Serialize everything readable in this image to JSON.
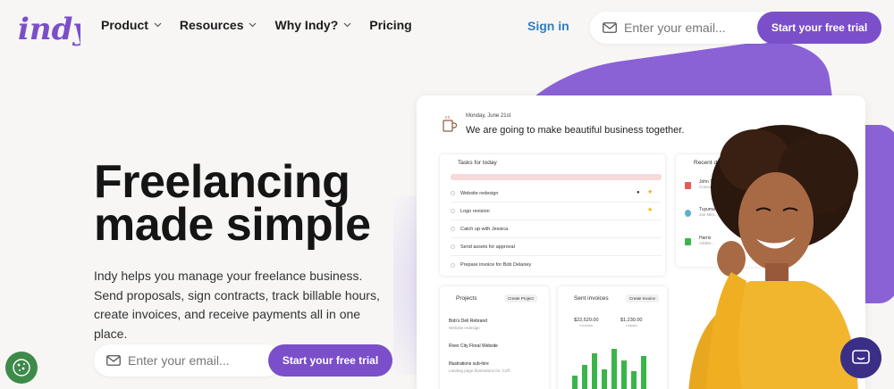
{
  "brand": {
    "logo_text": "indy",
    "color": "#7b4fc9"
  },
  "nav": [
    {
      "label": "Product",
      "has_dropdown": true
    },
    {
      "label": "Resources",
      "has_dropdown": true
    },
    {
      "label": "Why Indy?",
      "has_dropdown": true
    },
    {
      "label": "Pricing",
      "has_dropdown": false
    }
  ],
  "header": {
    "sign_in": "Sign in",
    "email_placeholder": "Enter your email...",
    "cta": "Start your free trial"
  },
  "hero": {
    "headline_line1": "Freelancing",
    "headline_line2": "made simple",
    "subcopy": "Indy helps you manage your freelance business. Send proposals, sign contracts, track billable hours, create invoices, and receive payments all in one place.",
    "email_placeholder": "Enter your email...",
    "cta": "Start your free trial"
  },
  "dashboard": {
    "date": "Monday, June 21st",
    "greeting": "We are going to make beautiful business together.",
    "tasks": {
      "title": "Tasks for today",
      "items": [
        "Website redesign",
        "Logo revision",
        "Catch up with Jessica",
        "Send assets for approval",
        "Prepare invoice for Bob Delaney"
      ]
    },
    "recent_docs": {
      "title": "Recent documents",
      "items": [
        {
          "name": "John Tash",
          "sub": "Consulting Agre..."
        },
        {
          "name": "Tuyuma",
          "sub": "Joe Mier..."
        },
        {
          "name": "Harris",
          "sub": "Adobe..."
        }
      ]
    },
    "projects": {
      "title": "Projects",
      "button": "Create Project",
      "items": [
        {
          "name": "Bob's Deli Rebrand",
          "sub": "Website redesign"
        },
        {
          "name": "River City Floral Website",
          "sub": ""
        },
        {
          "name": "Illustrations sub-hire",
          "sub": "Landing page illustrations for 'Coff..."
        }
      ]
    },
    "invoices": {
      "title": "Sent invoices",
      "button": "Create Invoice",
      "amounts": [
        {
          "value": "$22,520.00",
          "label": "Invoices"
        },
        {
          "value": "$1,230.00",
          "label": "Unpaid"
        }
      ],
      "bars": [
        {
          "h": 0.35,
          "neg": 0.15
        },
        {
          "h": 0.6,
          "neg": 0.1
        },
        {
          "h": 0.85,
          "neg": 0.2
        },
        {
          "h": 0.5,
          "neg": 0.15
        },
        {
          "h": 0.95,
          "neg": 0.1
        },
        {
          "h": 0.7,
          "neg": 0.2
        },
        {
          "h": 0.45,
          "neg": 0.15
        },
        {
          "h": 0.8,
          "neg": 0.1
        }
      ]
    }
  },
  "colors": {
    "purple": "#7b4fc9",
    "link_blue": "#2d7fbf",
    "chat": "#3b2e86",
    "cookie": "#3e8a4a"
  }
}
